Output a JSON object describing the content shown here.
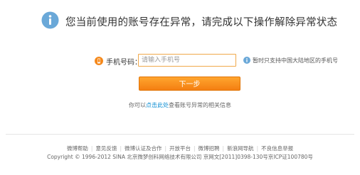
{
  "header": {
    "headline": "您当前使用的账号存在异常，请完成以下操作解除异常状态",
    "icon": "info-icon"
  },
  "form": {
    "phone_label": "手机号码：",
    "phone_placeholder": "请输入手机号",
    "phone_value": "",
    "tip_text": "暂时只支持中国大陆地区的手机号",
    "next_button": "下一步"
  },
  "help": {
    "prefix": "你可以",
    "link": "点击此处",
    "suffix": "查看账号异常的相关信息"
  },
  "footer": {
    "links": [
      {
        "label": "微博帮助"
      },
      {
        "label": "意见反馈"
      },
      {
        "label": "微博认证及合作"
      },
      {
        "label": "开放平台"
      },
      {
        "label": "微博招聘"
      },
      {
        "label": "新浪网导航"
      },
      {
        "label": "不良信息举报"
      }
    ],
    "copyright": "Copyright © 1996-2012 SINA 北京微梦创科网络技术有限公司  京网文[2011]0398-130号京ICP证100780号"
  },
  "colors": {
    "accent_orange": "#f5891c",
    "info_blue": "#6aa8d8",
    "link_blue": "#0a8cd2"
  }
}
